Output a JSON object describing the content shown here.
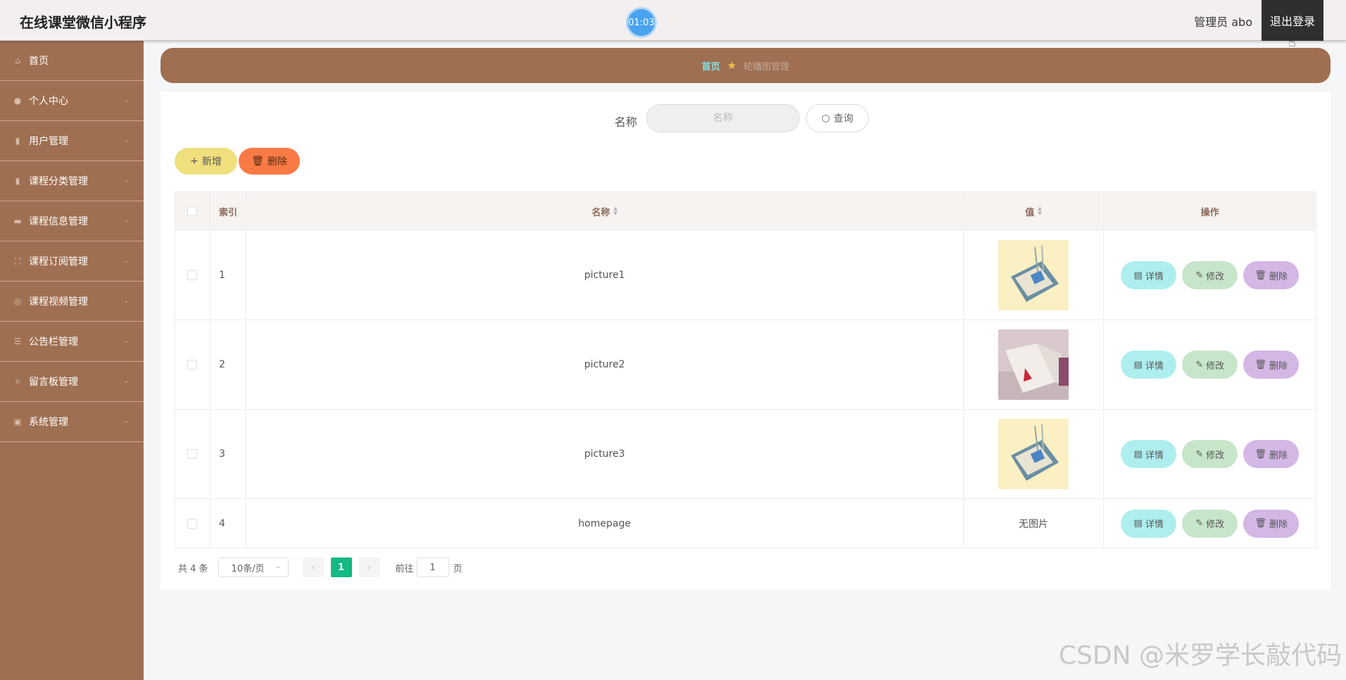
{
  "header": {
    "app_title": "在线课堂微信小程序",
    "timer": "01:03",
    "user_label": "管理员 abo",
    "logout_label": "退出登录"
  },
  "sidebar": {
    "items": [
      {
        "label": "首页",
        "icon": "home-icon",
        "has_submenu": false
      },
      {
        "label": "个人中心",
        "icon": "user-icon",
        "has_submenu": true
      },
      {
        "label": "用户管理",
        "icon": "clipboard-icon",
        "has_submenu": true
      },
      {
        "label": "课程分类管理",
        "icon": "clipboard-icon",
        "has_submenu": true
      },
      {
        "label": "课程信息管理",
        "icon": "monitor-icon",
        "has_submenu": true
      },
      {
        "label": "课程订阅管理",
        "icon": "frame-icon",
        "has_submenu": true
      },
      {
        "label": "课程视频管理",
        "icon": "globe-icon",
        "has_submenu": true
      },
      {
        "label": "公告栏管理",
        "icon": "list-icon",
        "has_submenu": true
      },
      {
        "label": "留言板管理",
        "icon": "crop-icon",
        "has_submenu": true
      },
      {
        "label": "系统管理",
        "icon": "image-icon",
        "has_submenu": true
      }
    ]
  },
  "breadcrumb": {
    "home": "首页",
    "current": "轮播图管理"
  },
  "search": {
    "label": "名称",
    "placeholder": "名称",
    "button": "查询"
  },
  "actions": {
    "add": "新增",
    "delete": "删除"
  },
  "table": {
    "columns": {
      "index": "索引",
      "name": "名称",
      "value": "值",
      "ops": "操作"
    },
    "rows": [
      {
        "index": "1",
        "name": "picture1",
        "has_image": true,
        "image": "book-image"
      },
      {
        "index": "2",
        "name": "picture2",
        "has_image": true,
        "image": "open-book-image"
      },
      {
        "index": "3",
        "name": "picture3",
        "has_image": true,
        "image": "book-image"
      },
      {
        "index": "4",
        "name": "homepage",
        "has_image": false,
        "no_image_text": "无图片"
      }
    ],
    "row_actions": {
      "detail": "详情",
      "edit": "修改",
      "delete": "删除"
    }
  },
  "pagination": {
    "total": "共 4 条",
    "page_size": "10条/页",
    "current_page": "1",
    "goto_prefix": "前往",
    "goto_value": "1",
    "goto_suffix": "页"
  },
  "watermark": "CSDN @米罗学长敲代码",
  "colors": {
    "sidebar": "#9f6f52",
    "primary": "#15b983",
    "add_button": "#efe07d",
    "delete_button": "#fa7a45"
  }
}
